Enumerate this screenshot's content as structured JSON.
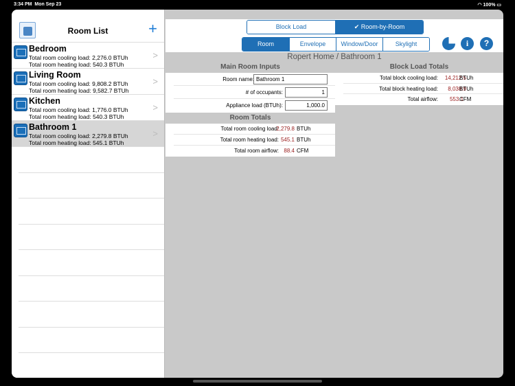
{
  "status": {
    "time": "3:34 PM",
    "date": "Mon Sep 23",
    "battery": "100%"
  },
  "sidebar": {
    "title": "Room List",
    "add": "+",
    "rooms": [
      {
        "name": "Bedroom",
        "cooling": "Total room cooling load: 2,276.0 BTUh",
        "heating": "Total room heating load: 540.3 BTUh"
      },
      {
        "name": "Living Room",
        "cooling": "Total room cooling load: 9,808.2 BTUh",
        "heating": "Total room heating load: 9,582.7 BTUh"
      },
      {
        "name": "Kitchen",
        "cooling": "Total room cooling load: 1,776.0 BTUh",
        "heating": "Total room heating load: 540.3 BTUh"
      },
      {
        "name": "Bathroom 1",
        "cooling": "Total room cooling load: 2,279.8 BTUh",
        "heating": "Total room heating load: 545.1 BTUh"
      }
    ]
  },
  "mode": {
    "block": "Block Load",
    "room": "✔ Room-by-Room"
  },
  "tabs": [
    "Room",
    "Envelope",
    "Window/Door",
    "Skylight"
  ],
  "icons": {
    "info": "i",
    "help": "?"
  },
  "breadcrumb": "Ropert Home / Bathroom 1",
  "inputs": {
    "heading": "Main Room Inputs",
    "name_label": "Room name:",
    "name_value": "Bathroom 1",
    "occ_label": "# of occupants:",
    "occ_value": "1",
    "app_label": "Appliance load (BTUh):",
    "app_value": "1,000.0"
  },
  "room_totals": {
    "heading": "Room Totals",
    "rows": [
      {
        "label": "Total room cooling load:",
        "value": "2,279.8",
        "unit": "BTUh"
      },
      {
        "label": "Total room heating load:",
        "value": "545.1",
        "unit": "BTUh"
      },
      {
        "label": "Total room airflow:",
        "value": "88.4",
        "unit": "CFM"
      }
    ]
  },
  "block_totals": {
    "heading": "Block Load Totals",
    "rows": [
      {
        "label": "Total block cooling load:",
        "value": "14,212.5",
        "unit": "BTUh"
      },
      {
        "label": "Total block heating load:",
        "value": "8,038.9",
        "unit": "BTUh"
      },
      {
        "label": "Total airflow:",
        "value": "553.1",
        "unit": "CFM"
      }
    ]
  }
}
